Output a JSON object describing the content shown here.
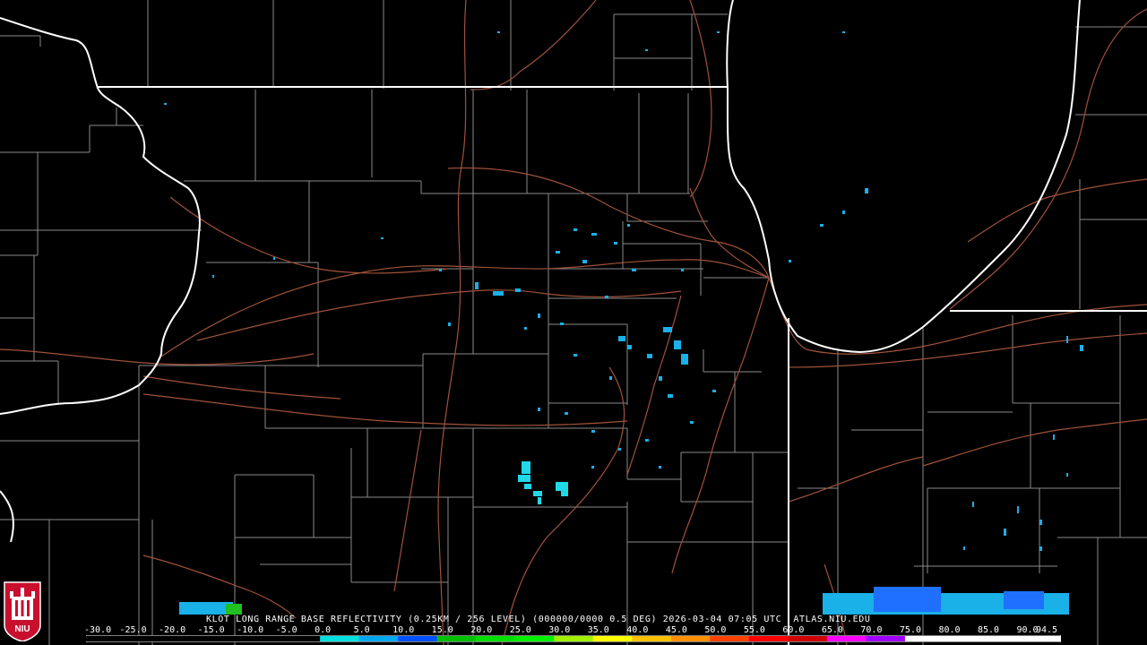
{
  "product": {
    "caption": "KLOT LONG RANGE BASE REFLECTIVITY (0.25KM / 256 LEVEL) (000000/0000 0.5 DEG) 2026-03-04 07:05 UTC  ATLAS.NIU.EDU"
  },
  "scale": {
    "labels": [
      "-30.0",
      "-25.0",
      "-20.0",
      "-15.0",
      "-10.0",
      "-5.0",
      "0.0",
      "5.0",
      "10.0",
      "15.0",
      "20.0",
      "25.0",
      "30.0",
      "35.0",
      "40.0",
      "45.0",
      "50.0",
      "55.0",
      "60.0",
      "65.0",
      "70.0",
      "75.0",
      "80.0",
      "85.0",
      "90.0",
      "94.5"
    ],
    "colors": [
      "#000000",
      "#000000",
      "#000000",
      "#000000",
      "#000000",
      "#000000",
      "#00e0e0",
      "#00a8f0",
      "#0050ff",
      "#00c000",
      "#00e000",
      "#00f000",
      "#a0f000",
      "#ffff00",
      "#f8c000",
      "#ff9000",
      "#ff4000",
      "#ff0000",
      "#d00000",
      "#ff00ff",
      "#a000ff",
      "#ffffff",
      "#ffffff",
      "#ffffff",
      "#ffffff"
    ]
  },
  "logo": {
    "text": "NIU"
  },
  "colors": {
    "background": "#000000",
    "state_border": "#ffffff",
    "county_border": "#888888",
    "highway": "#a0523a",
    "echo_light": "#1ab0e8",
    "echo_cyan": "#20d8e8",
    "echo_blue": "#2070ff",
    "echo_green": "#20c020"
  }
}
